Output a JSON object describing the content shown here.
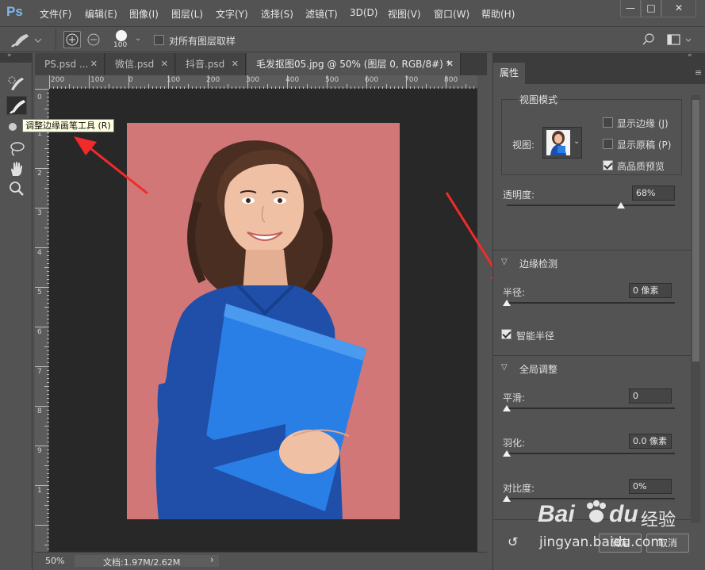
{
  "app": {
    "logo": "Ps",
    "menu": [
      "文件(F)",
      "编辑(E)",
      "图像(I)",
      "图层(L)",
      "文字(Y)",
      "选择(S)",
      "滤镜(T)",
      "3D(D)",
      "视图(V)",
      "窗口(W)",
      "帮助(H)"
    ],
    "window_buttons": [
      "—",
      "□",
      "✕"
    ]
  },
  "options": {
    "brush_size": "100",
    "sample_all_layers_label": "对所有图层取样"
  },
  "tabs": [
    {
      "label": "PS.psd ...",
      "close": "✕"
    },
    {
      "label": "微信.psd",
      "close": "✕"
    },
    {
      "label": "抖音.psd",
      "close": "✕"
    },
    {
      "label": "毛发抠图05.jpg @ 50% (图层 0, RGB/8#) *",
      "close": "✕"
    }
  ],
  "rulers": {
    "top": [
      "200",
      "100",
      "0",
      "100",
      "200",
      "300",
      "400",
      "500",
      "600",
      "700",
      "800"
    ],
    "left": [
      "0",
      "1",
      "2",
      "3",
      "4",
      "5",
      "6",
      "7",
      "8",
      "9",
      "1"
    ]
  },
  "tooltip": "调整边缘画笔工具 (R)",
  "status": {
    "zoom": "50%",
    "doc_info": "文档:1.97M/2.62M",
    "arrow": "›"
  },
  "properties": {
    "tab_label": "属性",
    "view_mode": {
      "title": "视图模式",
      "view_label": "视图:",
      "show_edge": "显示边缘 (J)",
      "show_original": "显示原稿 (P)",
      "high_quality": "高品质预览",
      "high_quality_checked": true,
      "show_edge_checked": false,
      "show_original_checked": false
    },
    "opacity": {
      "label": "透明度:",
      "value": "68%",
      "level": 0.68
    },
    "edge_detection": {
      "title": "边缘检测",
      "radius_label": "半径:",
      "radius_value": "0 像素",
      "radius_level": 0,
      "smart_radius": "智能半径",
      "smart_radius_checked": true
    },
    "global": {
      "title": "全局调整",
      "smooth_label": "平滑:",
      "smooth_value": "0",
      "smooth_level": 0,
      "feather_label": "羽化:",
      "feather_value": "0.0 像素",
      "feather_level": 0,
      "contrast_label": "对比度:",
      "contrast_value": "0%",
      "contrast_level": 0
    },
    "buttons": {
      "reset_icon": "↺",
      "ok": "确定",
      "cancel": "取消"
    }
  },
  "watermark": {
    "brand": "Bai",
    "brand2": "du",
    "brand_cn": "经验",
    "url": "jingyan.baidu.com"
  }
}
